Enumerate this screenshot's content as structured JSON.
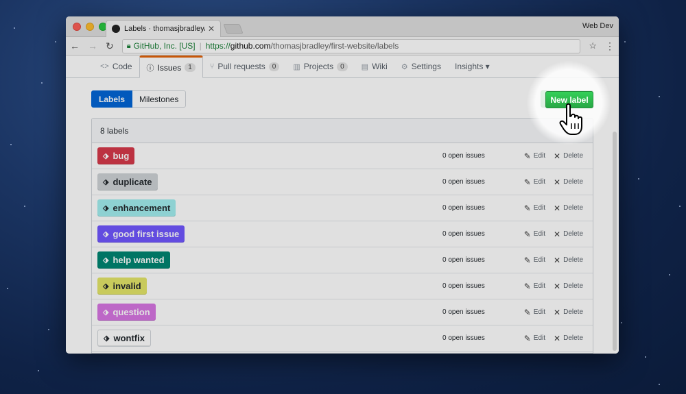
{
  "browser": {
    "tab_title": "Labels · thomasjbradley/first-w",
    "tab_close": "✕",
    "profile": "Web Dev",
    "security_label": "GitHub, Inc. [US]",
    "url_proto": "https://",
    "url_host": "github.com",
    "url_path": "/thomasjbradley/first-website/labels"
  },
  "repo_nav": {
    "items": [
      {
        "label": "Code",
        "icon": "code-icon"
      },
      {
        "label": "Issues",
        "icon": "issue-icon",
        "count": "1",
        "selected": true
      },
      {
        "label": "Pull requests",
        "icon": "pull-request-icon",
        "count": "0"
      },
      {
        "label": "Projects",
        "icon": "project-icon",
        "count": "0"
      },
      {
        "label": "Wiki",
        "icon": "book-icon"
      },
      {
        "label": "Settings",
        "icon": "gear-icon"
      },
      {
        "label": "Insights ▾",
        "icon": ""
      }
    ]
  },
  "subnav": {
    "labels": "Labels",
    "milestones": "Milestones"
  },
  "new_label_button": "New label",
  "list": {
    "count_text": "8 labels",
    "open_issues": "0 open issues",
    "edit_label": "Edit",
    "delete_label": "Delete",
    "labels": [
      {
        "name": "bug",
        "color": "#d73a4a",
        "text_color": "#ffffff"
      },
      {
        "name": "duplicate",
        "color": "#cfd3d7",
        "text_color": "#24292e"
      },
      {
        "name": "enhancement",
        "color": "#a2eeef",
        "text_color": "#24292e"
      },
      {
        "name": "good first issue",
        "color": "#7057ff",
        "text_color": "#ffffff"
      },
      {
        "name": "help wanted",
        "color": "#008672",
        "text_color": "#ffffff"
      },
      {
        "name": "invalid",
        "color": "#e4e669",
        "text_color": "#24292e"
      },
      {
        "name": "question",
        "color": "#d876e3",
        "text_color": "#ffffff"
      },
      {
        "name": "wontfix",
        "color": "#ffffff",
        "text_color": "#24292e"
      }
    ]
  }
}
